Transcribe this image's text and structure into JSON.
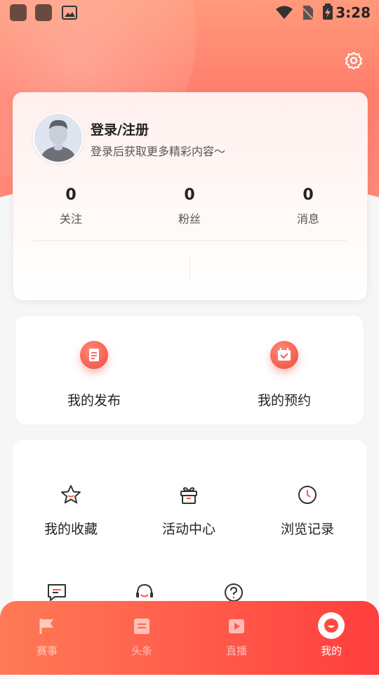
{
  "status_bar": {
    "time": "3:28"
  },
  "user": {
    "login_title": "登录/注册",
    "login_subtitle": "登录后获取更多精彩内容～",
    "stats": [
      {
        "value": "0",
        "label": "关注"
      },
      {
        "value": "0",
        "label": "粉丝"
      },
      {
        "value": "0",
        "label": "消息"
      }
    ]
  },
  "quick_actions": [
    {
      "label": "我的发布",
      "icon": "document-icon"
    },
    {
      "label": "我的预约",
      "icon": "calendar-check-icon"
    }
  ],
  "menu_grid": [
    {
      "label": "我的收藏",
      "icon": "star-icon"
    },
    {
      "label": "活动中心",
      "icon": "gift-icon"
    },
    {
      "label": "浏览记录",
      "icon": "clock-icon"
    }
  ],
  "menu_grid_row2_icons": [
    "message-icon",
    "headset-icon",
    "help-icon"
  ],
  "tabbar": [
    {
      "label": "赛事",
      "icon": "flag-icon"
    },
    {
      "label": "头条",
      "icon": "news-icon"
    },
    {
      "label": "直播",
      "icon": "play-icon"
    },
    {
      "label": "我的",
      "icon": "profile-icon",
      "active": true
    }
  ],
  "colors": {
    "accent": "#ff5a4a",
    "hero": "#ff8a70"
  }
}
